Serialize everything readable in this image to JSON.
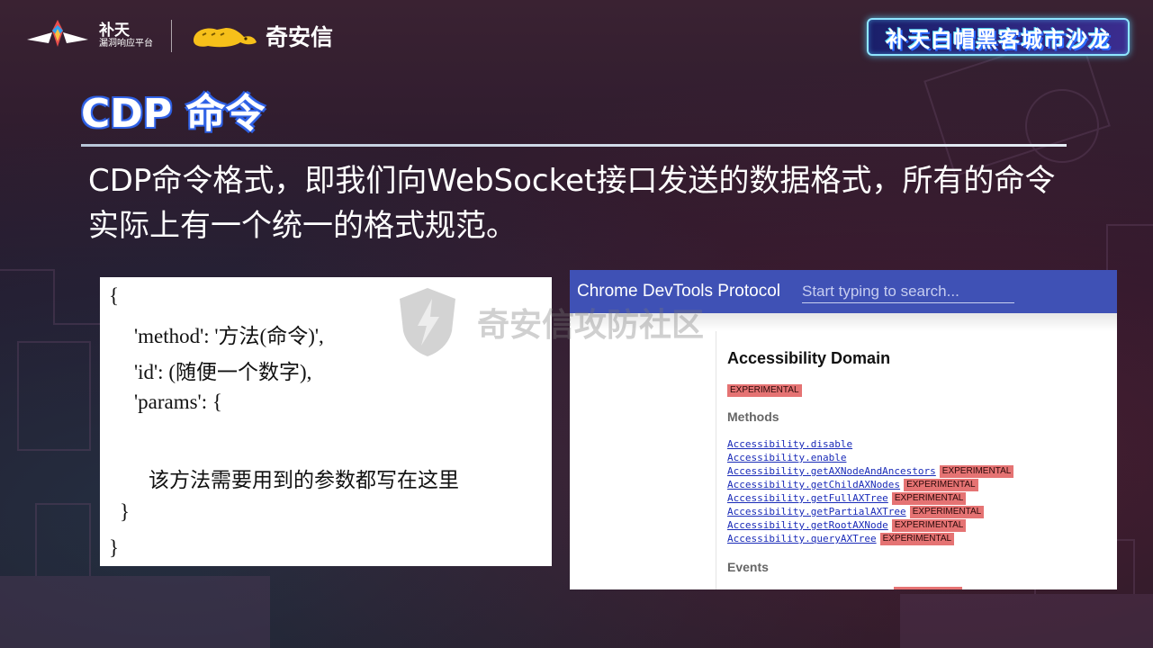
{
  "header": {
    "butian_title": "补天",
    "butian_subtitle": "漏洞响应平台",
    "qax_name": "奇安信",
    "salon_title": "补天白帽黑客城市沙龙"
  },
  "slide": {
    "title": "CDP 命令",
    "intro": "CDP命令格式，即我们向WebSocket接口发送的数据格式，所有的命令实际上有一个统一的格式规范。"
  },
  "code": {
    "lines": [
      "{",
      "'method': '方法(命令)',",
      "'id': (随便一个数字),",
      "'params': {",
      "该方法需要用到的参数都写在这里",
      "}",
      "}"
    ]
  },
  "cdp": {
    "app_title": "Chrome DevTools Protocol",
    "search_placeholder": "Start typing to search...",
    "domain_title": "Accessibility Domain",
    "experimental": "EXPERIMENTAL",
    "methods_heading": "Methods",
    "events_heading": "Events",
    "methods": [
      {
        "name": "Accessibility.disable",
        "badge": ""
      },
      {
        "name": "Accessibility.enable",
        "badge": ""
      },
      {
        "name": "Accessibility.getAXNodeAndAncestors",
        "badge": "EXPERIMENTAL"
      },
      {
        "name": "Accessibility.getChildAXNodes",
        "badge": "EXPERIMENTAL"
      },
      {
        "name": "Accessibility.getFullAXTree",
        "badge": "EXPERIMENTAL"
      },
      {
        "name": "Accessibility.getPartialAXTree",
        "badge": "EXPERIMENTAL"
      },
      {
        "name": "Accessibility.getRootAXNode",
        "badge": "EXPERIMENTAL"
      },
      {
        "name": "Accessibility.queryAXTree",
        "badge": "EXPERIMENTAL"
      }
    ]
  },
  "watermark": {
    "text": "奇安信攻防社区"
  },
  "colors": {
    "devtools_header": "#3f51b5",
    "experimental_badge": "#e57373",
    "title_glow": "#2d5ee0"
  }
}
